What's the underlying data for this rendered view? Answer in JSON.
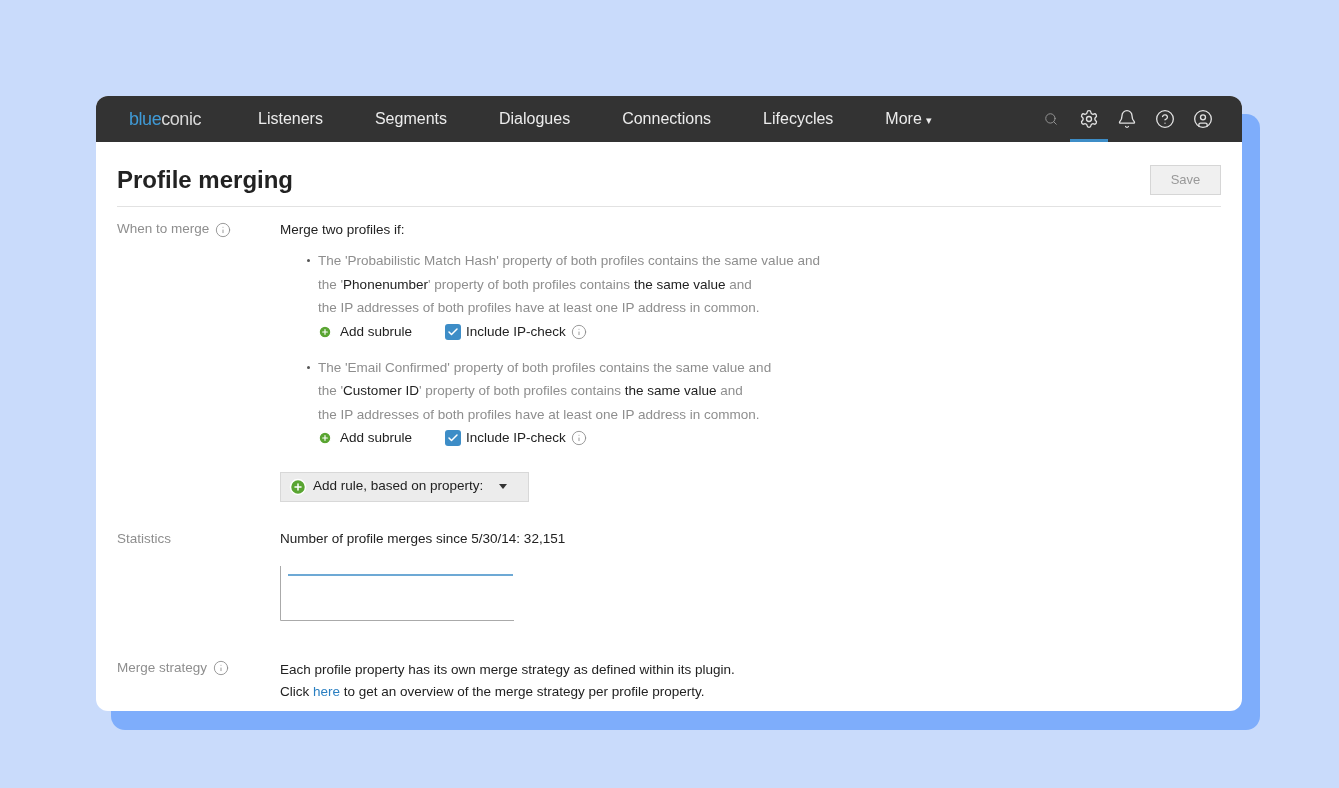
{
  "nav": {
    "logo": [
      "blue",
      "conic"
    ],
    "items": [
      {
        "label": "Listeners"
      },
      {
        "label": "Segments"
      },
      {
        "label": "Dialogues"
      },
      {
        "label": "Connections"
      },
      {
        "label": "Lifecycles"
      },
      {
        "label": "More",
        "caret": "▾"
      }
    ],
    "icons": [
      {
        "kind": "search",
        "selected": false
      },
      {
        "kind": "settings",
        "selected": true
      },
      {
        "kind": "alerts",
        "selected": false
      },
      {
        "kind": "help",
        "selected": false
      },
      {
        "kind": "account",
        "selected": false
      }
    ]
  },
  "title": "Profile merging",
  "save_button": {
    "label": "Save",
    "disabled": true
  },
  "when_to_merge": {
    "label": "When to merge",
    "intro": "Merge two profiles if:",
    "rules": [
      {
        "lines": [
          "The 'Probabilistic Match Hash' property of both profiles contains the same value and",
          "the '**Phonenumber**' property of both profiles contains **the same value** and",
          "the IP addresses of both profiles have at least one IP address in common."
        ],
        "add_subrule": "Add subrule",
        "ip_check": {
          "label": "Include IP-check",
          "checked": true
        }
      },
      {
        "lines": [
          "The 'Email Confirmed' property of both profiles contains the same value and",
          "the '**Customer ID**' property of both profiles contains **the same value** and",
          "the IP addresses of both profiles have at least one IP address in common."
        ],
        "add_subrule": "Add subrule",
        "ip_check": {
          "label": "Include IP-check",
          "checked": true
        }
      }
    ],
    "add_rule": "Add rule, based on property:"
  },
  "statistics": {
    "label": "Statistics",
    "text": "Number of profile merges since 5/30/14: 32,151"
  },
  "merge_strategy": {
    "label": "Merge strategy",
    "line1": "Each profile property has its own merge strategy as defined within its plugin.",
    "line2_before": "Click",
    "link": "here",
    "line2_after": "to get an overview of the merge strategy per profile property."
  }
}
